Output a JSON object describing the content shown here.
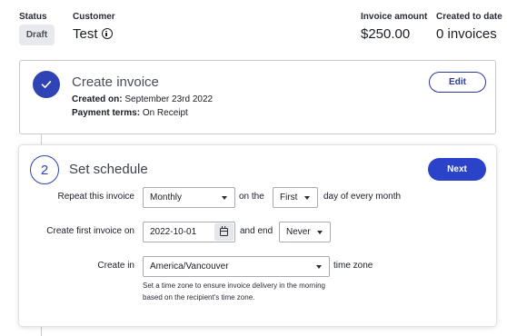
{
  "header": {
    "status_label": "Status",
    "status_value": "Draft",
    "customer_label": "Customer",
    "customer_value": "Test",
    "amount_label": "Invoice amount",
    "amount_value": "$250.00",
    "created_label": "Created to date",
    "created_value": "0 invoices"
  },
  "step1": {
    "title": "Create invoice",
    "created_on_label": "Created on:",
    "created_on_value": "September 23rd 2022",
    "payment_terms_label": "Payment terms:",
    "payment_terms_value": "On Receipt",
    "edit_label": "Edit",
    "icon": "checkmark-icon"
  },
  "step2": {
    "number": "2",
    "title": "Set schedule",
    "next_label": "Next",
    "repeat_label": "Repeat this invoice",
    "repeat_value": "Monthly",
    "on_the_text": "on the",
    "day_value": "First",
    "day_suffix": "day of every month",
    "first_invoice_label": "Create first invoice on",
    "first_invoice_date": "2022-10-01",
    "and_end_text": "and end",
    "end_value": "Never",
    "create_in_label": "Create in",
    "timezone_value": "America/Vancouver",
    "timezone_suffix": "time zone",
    "help_line1": "Set a time zone to ensure invoice delivery in the morning",
    "help_line2": "based on the recipient's time zone."
  },
  "colors": {
    "accent": "#2a43c9",
    "accent_dark": "#283a9a",
    "badge_bg": "#e8e9ed",
    "border": "#c7c9d1"
  }
}
